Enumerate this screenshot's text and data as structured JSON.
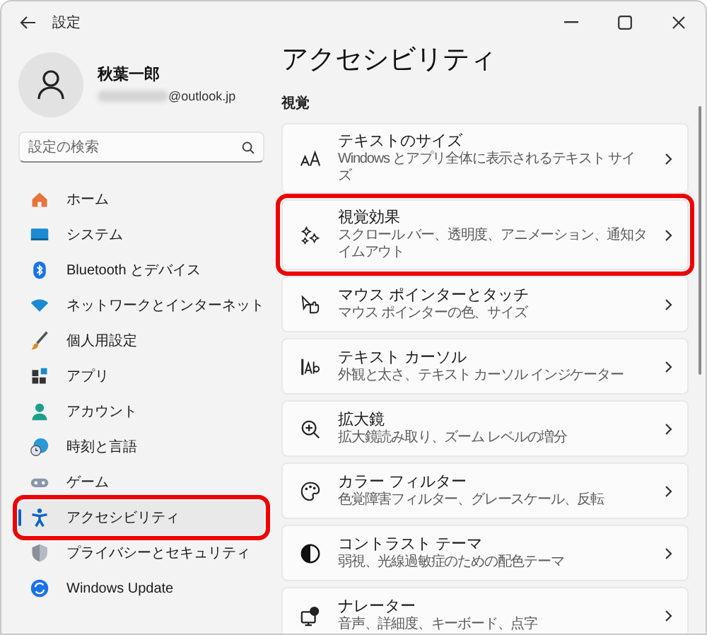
{
  "window": {
    "title": "設定"
  },
  "account": {
    "name": "秋葉一郎",
    "email": "@outlook.jp"
  },
  "search": {
    "placeholder": "設定の検索"
  },
  "sidebar": {
    "items": [
      {
        "label": "ホーム",
        "selected": false,
        "highlighted": false
      },
      {
        "label": "システム",
        "selected": false,
        "highlighted": false
      },
      {
        "label": "Bluetooth とデバイス",
        "selected": false,
        "highlighted": false
      },
      {
        "label": "ネットワークとインターネット",
        "selected": false,
        "highlighted": false
      },
      {
        "label": "個人用設定",
        "selected": false,
        "highlighted": false
      },
      {
        "label": "アプリ",
        "selected": false,
        "highlighted": false
      },
      {
        "label": "アカウント",
        "selected": false,
        "highlighted": false
      },
      {
        "label": "時刻と言語",
        "selected": false,
        "highlighted": false
      },
      {
        "label": "ゲーム",
        "selected": false,
        "highlighted": false
      },
      {
        "label": "アクセシビリティ",
        "selected": true,
        "highlighted": true
      },
      {
        "label": "プライバシーとセキュリティ",
        "selected": false,
        "highlighted": false
      },
      {
        "label": "Windows Update",
        "selected": false,
        "highlighted": false
      }
    ]
  },
  "page": {
    "title": "アクセシビリティ",
    "section": "視覚",
    "cards": [
      {
        "title": "テキストのサイズ",
        "description": "Windows とアプリ全体に表示されるテキスト サイズ",
        "highlighted": false
      },
      {
        "title": "視覚効果",
        "description": "スクロール バー、透明度、アニメーション、通知タイムアウト",
        "highlighted": true
      },
      {
        "title": "マウス ポインターとタッチ",
        "description": "マウス ポインターの色、サイズ",
        "highlighted": false
      },
      {
        "title": "テキスト カーソル",
        "description": "外観と太さ、テキスト カーソル インジケーター",
        "highlighted": false
      },
      {
        "title": "拡大鏡",
        "description": "拡大鏡読み取り、ズーム レベルの増分",
        "highlighted": false
      },
      {
        "title": "カラー フィルター",
        "description": "色覚障害フィルター、グレースケール、反転",
        "highlighted": false
      },
      {
        "title": "コントラスト テーマ",
        "description": "弱視、光線過敏症のための配色テーマ",
        "highlighted": false
      },
      {
        "title": "ナレーター",
        "description": "音声、詳細度、キーボード、点字",
        "highlighted": false
      }
    ]
  }
}
